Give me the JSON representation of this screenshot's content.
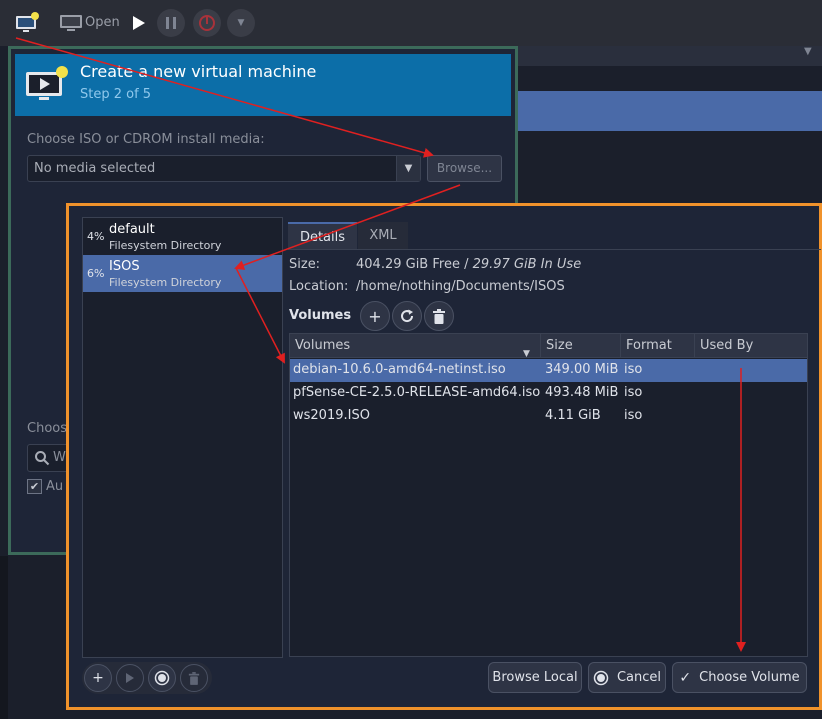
{
  "toolbar": {
    "open_label": "Open"
  },
  "wizard": {
    "title": "Create a new virtual machine",
    "step": "Step 2 of 5",
    "iso_label": "Choose ISO or CDROM install media:",
    "media_value": "No media selected",
    "browse_label": "Browse...",
    "choose_fragment": "Choos",
    "search_fragment": "W",
    "auto_fragment": "Au"
  },
  "storage": {
    "pools": [
      {
        "percent": "4%",
        "name": "default",
        "type": "Filesystem Directory"
      },
      {
        "percent": "6%",
        "name": "ISOS",
        "type": "Filesystem Directory"
      }
    ],
    "tabs": [
      "Details",
      "XML"
    ],
    "size_label": "Size:",
    "size_free": "404.29 GiB Free",
    "size_separator": " / ",
    "size_used": "29.97 GiB In Use",
    "location_label": "Location:",
    "location_value": "/home/nothing/Documents/ISOS",
    "volumes_label": "Volumes",
    "columns": [
      "Volumes",
      "Size",
      "Format",
      "Used By"
    ],
    "volumes": [
      {
        "name": "debian-10.6.0-amd64-netinst.iso",
        "size": "349.00 MiB",
        "format": "iso",
        "used_by": ""
      },
      {
        "name": "pfSense-CE-2.5.0-RELEASE-amd64.iso",
        "size": "493.48 MiB",
        "format": "iso",
        "used_by": ""
      },
      {
        "name": "ws2019.ISO",
        "size": "4.11 GiB",
        "format": "iso",
        "used_by": ""
      }
    ],
    "browse_local_label": "Browse Local",
    "cancel_label": "Cancel",
    "choose_volume_label": "Choose Volume"
  },
  "colors": {
    "accent_header": "#0c6ea8",
    "selection": "#4a6aa8",
    "annotation_border": "#f0922b",
    "annotation_arrow": "#e02020"
  }
}
